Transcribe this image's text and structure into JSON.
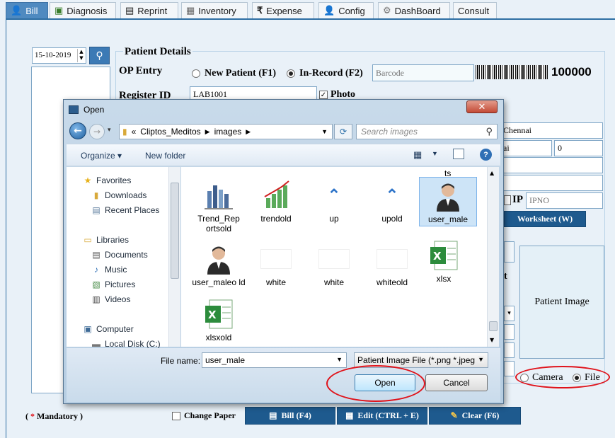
{
  "tabs": [
    {
      "label": "Bill",
      "icon": "user-icon",
      "active": true
    },
    {
      "label": "Diagnosis",
      "icon": "diagnosis-icon"
    },
    {
      "label": "Reprint",
      "icon": "reprint-icon"
    },
    {
      "label": "Inventory",
      "icon": "inventory-icon"
    },
    {
      "label": "Expense",
      "icon": "rupee-icon"
    },
    {
      "label": "Config",
      "icon": "config-icon"
    },
    {
      "label": "DashBoard",
      "icon": "dashboard-icon"
    },
    {
      "label": "Consult",
      "icon": ""
    }
  ],
  "left": {
    "date": "15-10-2019"
  },
  "patient": {
    "section_title": "Patient Details",
    "op_entry_label": "OP Entry",
    "new_patient_label": "New Patient (F1)",
    "in_record_label": "In-Record (F2)",
    "barcode_placeholder": "Barcode",
    "barcode_number": "100000",
    "register_id_label": "Register ID",
    "register_id_value": "LAB1001",
    "photo_label": "Photo",
    "city_value": "Chennai",
    "partial_text": "ai",
    "age_value": "0",
    "ip_label": "IP",
    "ipno_placeholder": "IPNO",
    "worksheet_label": "Worksheet (W)",
    "partial_t": "t",
    "patient_image_label": "Patient Image",
    "camera_label": "Camera",
    "file_label": "File"
  },
  "footer": {
    "mandatory_star": "*",
    "mandatory_text": "Mandatory )",
    "mandatory_open": "(",
    "change_paper": "Change Paper",
    "bill_btn": "Bill (F4)",
    "edit_btn": "Edit (CTRL + E)",
    "clear_btn": "Clear (F6)"
  },
  "dialog": {
    "title": "Open",
    "close_label": "✕",
    "address": {
      "sep": "«",
      "path": [
        "Cliptos_Meditos",
        "images"
      ]
    },
    "search_placeholder": "Search images",
    "toolbar": {
      "organize": "Organize ▾",
      "new_folder": "New folder"
    },
    "nav": [
      {
        "label": "Favorites",
        "icon": "star-icon",
        "indent": 0
      },
      {
        "label": "Downloads",
        "icon": "downloads-icon",
        "indent": 1
      },
      {
        "label": "Recent Places",
        "icon": "recent-places-icon",
        "indent": 1
      },
      {
        "label": "Libraries",
        "icon": "libraries-icon",
        "indent": 0
      },
      {
        "label": "Documents",
        "icon": "documents-icon",
        "indent": 1
      },
      {
        "label": "Music",
        "icon": "music-icon",
        "indent": 1
      },
      {
        "label": "Pictures",
        "icon": "pictures-icon",
        "indent": 1
      },
      {
        "label": "Videos",
        "icon": "videos-icon",
        "indent": 1
      },
      {
        "label": "Computer",
        "icon": "computer-icon",
        "indent": 0
      },
      {
        "label": "Local Disk (C:)",
        "icon": "disk-icon",
        "indent": 1
      }
    ],
    "top_partial": "ts",
    "files": [
      {
        "label": "Trend_Rep ortsold",
        "icon": "bar-chart-icon"
      },
      {
        "label": "trendold",
        "icon": "trend-icon"
      },
      {
        "label": "up",
        "icon": "up-arrow-icon"
      },
      {
        "label": "upold",
        "icon": "up-arrow-icon"
      },
      {
        "label": "user_male",
        "icon": "user-male-icon",
        "selected": true
      },
      {
        "label": "user_maleo ld",
        "icon": "user-male-icon"
      },
      {
        "label": "white",
        "icon": "blank-icon"
      },
      {
        "label": "white",
        "icon": "blank-icon"
      },
      {
        "label": "whiteold",
        "icon": "blank-icon"
      },
      {
        "label": "xlsx",
        "icon": "excel-icon"
      },
      {
        "label": "xlsxold",
        "icon": "excel-icon"
      }
    ],
    "file_name_label": "File name:",
    "file_name_value": "user_male",
    "filter_value": "Patient Image File (*.png *.jpeg",
    "open_btn": "Open",
    "cancel_btn": "Cancel"
  },
  "colors": {
    "accent": "#1e5a8e",
    "tab_active": "#4f8ac0",
    "highlight": "#e0121a"
  }
}
